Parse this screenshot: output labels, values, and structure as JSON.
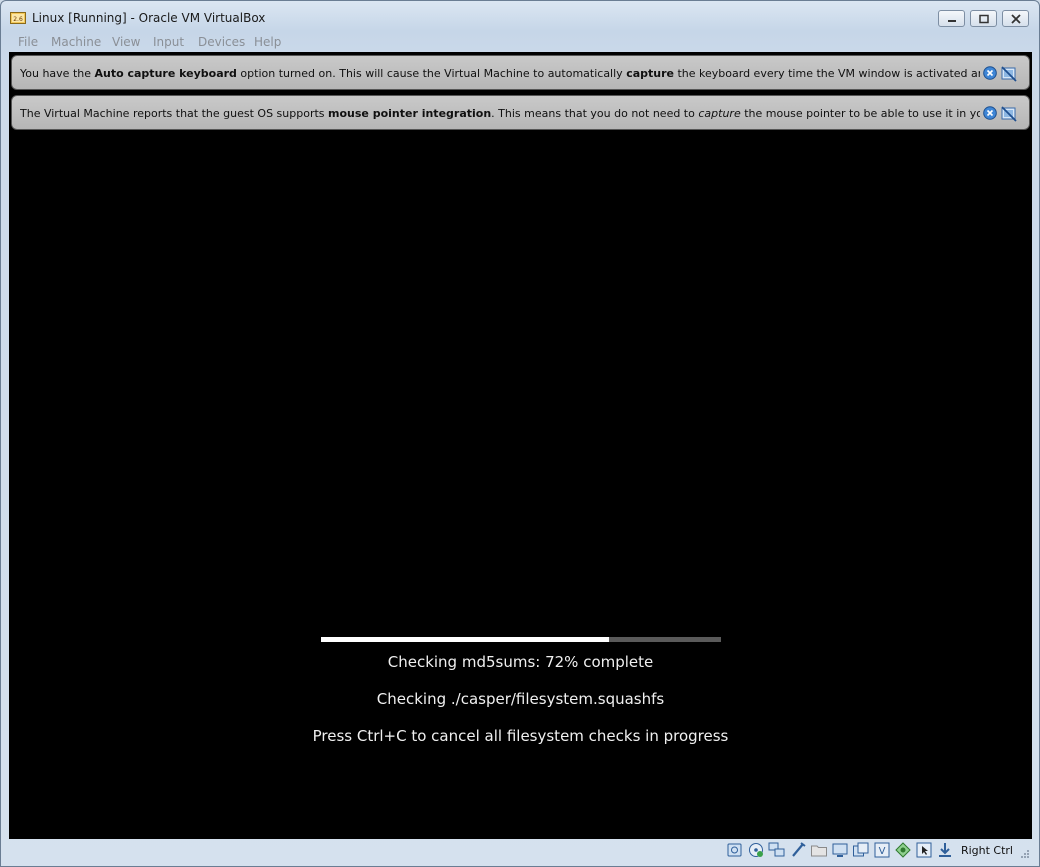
{
  "window": {
    "title": "Linux [Running] - Oracle VM VirtualBox"
  },
  "menu": {
    "items": [
      "File",
      "Machine",
      "View",
      "Input",
      "Devices",
      "Help"
    ]
  },
  "popups": {
    "keyboard": {
      "pre": "You have the ",
      "bold1": "Auto capture keyboard",
      "mid1": " option turned on. This will cause the Virtual Machine to automatically ",
      "bold2": "capture",
      "post": " the keyboard every time the VM window is activated and make it unavailable to"
    },
    "mouse": {
      "pre": "The Virtual Machine reports that the guest OS supports ",
      "bold1": "mouse pointer integration",
      "mid1": ". This means that you do not need to ",
      "italic1": "capture",
      "post": " the mouse pointer to be able to use it in your guest OS -- all mouse"
    }
  },
  "boot": {
    "progress": 0.72,
    "line1": "Checking md5sums: 72% complete",
    "line2": "Checking ./casper/filesystem.squashfs",
    "line3": "Press Ctrl+C to cancel all filesystem checks in progress"
  },
  "statusbar": {
    "host_key": "Right Ctrl",
    "icons": [
      "hard-disk-icon",
      "optical-drive-icon",
      "network-icon",
      "usb-icon",
      "shared-folders-icon",
      "display-icon",
      "video-capture-icon",
      "vrde-icon",
      "guest-additions-icon",
      "mouse-integration-icon",
      "keyboard-capture-icon"
    ]
  },
  "colors": {
    "vm_background": "#000000",
    "progress_fill": "#ffffff",
    "progress_track": "#5a5a5a",
    "popup_bg": "#c0c0c0"
  }
}
